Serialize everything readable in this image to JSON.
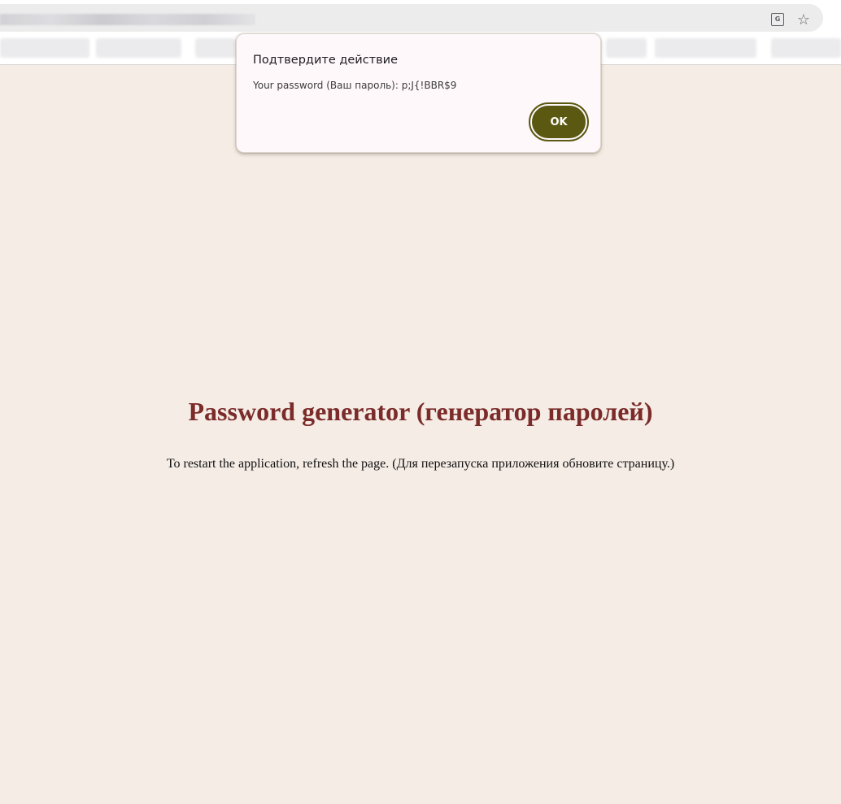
{
  "browser": {
    "icons": {
      "translate": "translate-icon",
      "bookmark_star": "star-icon"
    }
  },
  "dialog": {
    "title": "Подтвердите действие",
    "message": "Your password (Ваш пароль): p;J{!BBR$9",
    "ok_label": "OK"
  },
  "page": {
    "title": "Password generator (генератор паролей)",
    "note": "To restart the application, refresh the page. (Для перезапуска приложения обновите страницу.)"
  },
  "colors": {
    "page_background": "#f4ece5",
    "title": "#7b2b29",
    "ok_button": "#5a5811",
    "dialog_background": "#fff8fb"
  }
}
